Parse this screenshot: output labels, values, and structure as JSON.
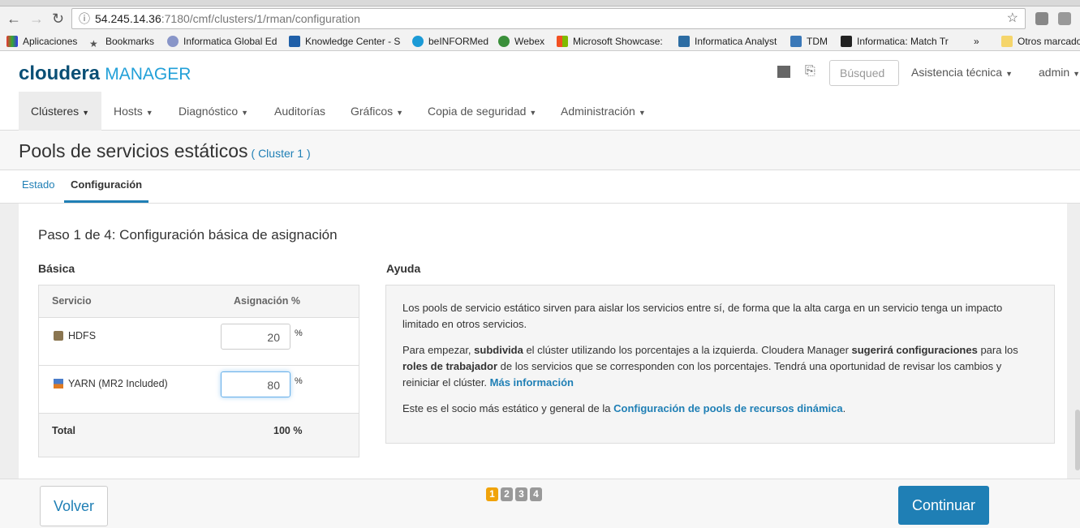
{
  "browser": {
    "url_host": "54.245.14.36",
    "url_path": ":7180/cmf/clusters/1/rman/configuration",
    "bookmarks": [
      "Aplicaciones",
      "Bookmarks",
      "Informatica Global Ed",
      "Knowledge Center - S",
      "beINFORMed",
      "Webex",
      "Microsoft Showcase:",
      "Informatica Analyst",
      "TDM",
      "Informatica: Match Tr",
      "»",
      "Otros marcadores"
    ]
  },
  "header": {
    "logo_main": "cloudera",
    "logo_sub": "MANAGER",
    "search_placeholder": "Búsqued",
    "support": "Asistencia técnica",
    "user": "admin"
  },
  "nav": [
    "Clústeres",
    "Hosts",
    "Diagnóstico",
    "Auditorías",
    "Gráficos",
    "Copia de seguridad",
    "Administración"
  ],
  "page": {
    "title": "Pools de servicios estáticos",
    "cluster_link": "( Cluster 1 )",
    "tabs": [
      "Estado",
      "Configuración"
    ],
    "active_tab": 1
  },
  "step_title": "Paso 1 de 4: Configuración básica de asignación",
  "basic": {
    "heading": "Básica",
    "col_service": "Servicio",
    "col_alloc": "Asignación %",
    "rows": [
      {
        "service": "HDFS",
        "value": "20",
        "unit": "%"
      },
      {
        "service": "YARN (MR2 Included)",
        "value": "80",
        "unit": "%"
      }
    ],
    "total_label": "Total",
    "total_value": "100 %"
  },
  "help": {
    "heading": "Ayuda",
    "p1": "Los pools de servicio estático sirven para aislar los servicios entre sí, de forma que la alta carga en un servicio tenga un impacto limitado en otros servicios.",
    "p2a": "Para empezar, ",
    "p2b": "subdivida",
    "p2c": " el clúster utilizando los porcentajes a la izquierda. Cloudera Manager ",
    "p2d": "sugerirá configuraciones",
    "p2e": " para los ",
    "p2f": "roles de trabajador",
    "p2g": " de los servicios que se corresponden con los porcentajes. Tendrá una oportunidad de revisar los cambios y reiniciar el clúster. ",
    "p2link": "Más información",
    "p3a": "Este es el socio más estático y general de la ",
    "p3link": "Configuración de pools de recursos dinámica",
    "p3b": "."
  },
  "footer": {
    "back": "Volver",
    "continue": "Continuar",
    "steps": [
      "1",
      "2",
      "3",
      "4"
    ],
    "current_step": 1
  },
  "colors": {
    "accent": "#1f7fb5",
    "step_active": "#f0a30a"
  }
}
